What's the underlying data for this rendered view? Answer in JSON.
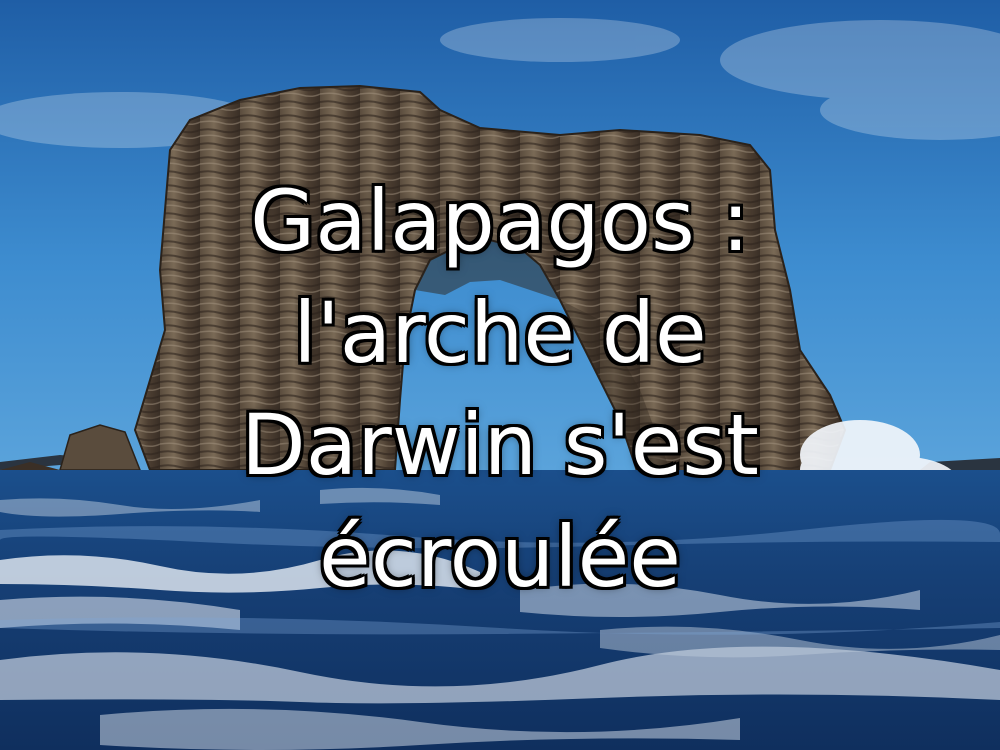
{
  "headline": {
    "lines": [
      "Galapagos :",
      "l'arche de",
      "Darwin s'est",
      "écroulée"
    ]
  },
  "colors": {
    "sky_top": "#1f5ea6",
    "sky_bottom": "#4a9ad8",
    "rock": "#4a3e33",
    "rock_light": "#8a7a66",
    "sea": "#16407a",
    "foam": "#e8eef6"
  }
}
